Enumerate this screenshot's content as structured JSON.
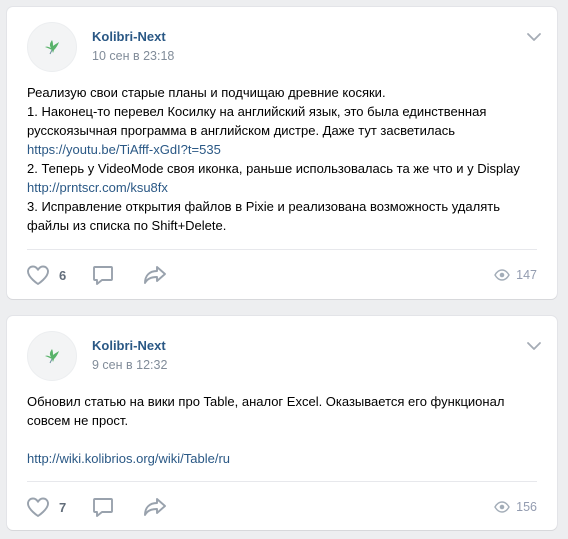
{
  "icons": {
    "avatar": "hummingbird-logo-icon",
    "menu": "chevron-down-icon",
    "like": "heart-icon",
    "comment": "comment-bubble-icon",
    "share": "share-arrow-icon",
    "views": "eye-icon"
  },
  "colors": {
    "page_bg": "#edeef0",
    "card_bg": "#ffffff",
    "link": "#2a5885",
    "meta": "#818c99",
    "action_icon": "#99a2ad"
  },
  "posts": [
    {
      "author": "Kolibri-Next",
      "date": "10 сен в 23:18",
      "lines": [
        {
          "text": "Реализую свои старые планы и подчищаю древние косяки.",
          "link": false
        },
        {
          "text": "1. Наконец-то перевел Косилку на английский язык, это была единственная",
          "link": false
        },
        {
          "text": "русскоязычная программа в английском дистре. Даже тут засветилась",
          "link": false
        },
        {
          "text": "https://youtu.be/TiAfff-xGdI?t=535",
          "link": true
        },
        {
          "text": "2. Теперь у VideoMode своя иконка, раньше использовалась та же что и у Display",
          "link": false
        },
        {
          "text": "http://prntscr.com/ksu8fx",
          "link": true
        },
        {
          "text": "3. Исправление открытия файлов в Pixie и реализована возможность удалять",
          "link": false
        },
        {
          "text": "файлы из списка по Shift+Delete.",
          "link": false
        }
      ],
      "likes": "6",
      "views": "147"
    },
    {
      "author": "Kolibri-Next",
      "date": "9 сен в 12:32",
      "lines": [
        {
          "text": "Обновил статью на вики про Table, аналог Excel. Оказывается его функционал",
          "link": false
        },
        {
          "text": "совсем не прост.",
          "link": false
        },
        {
          "text": "",
          "link": false
        },
        {
          "text": "http://wiki.kolibrios.org/wiki/Table/ru",
          "link": true
        }
      ],
      "likes": "7",
      "views": "156"
    }
  ]
}
